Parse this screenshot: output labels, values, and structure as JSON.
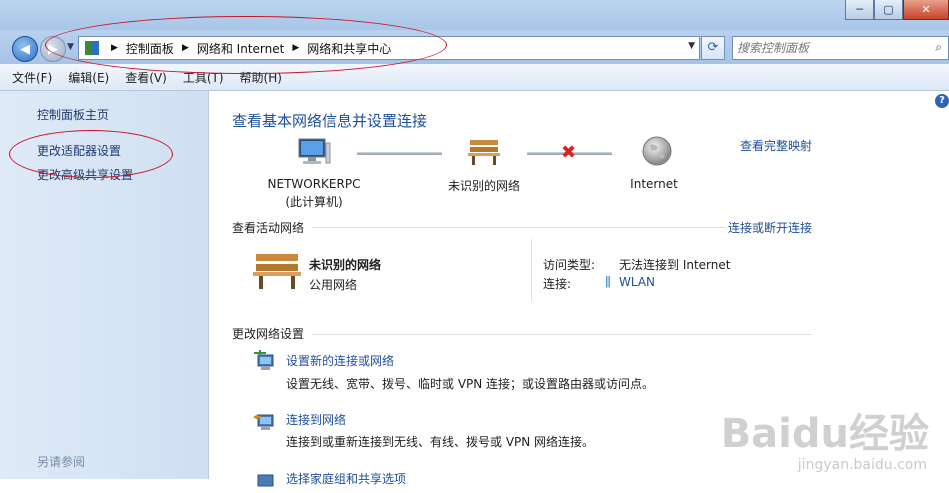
{
  "window": {
    "min": "─",
    "max": "▢",
    "close": "✕"
  },
  "nav": {
    "back_glyph": "◀",
    "forward_glyph": "▶",
    "recent_glyph": "▼",
    "refresh_glyph": "⟳"
  },
  "breadcrumb": [
    "控制面板",
    "网络和 Internet",
    "网络和共享中心"
  ],
  "search": {
    "placeholder": "搜索控制面板"
  },
  "menu": [
    "文件(F)",
    "编辑(E)",
    "查看(V)",
    "工具(T)",
    "帮助(H)"
  ],
  "sidebar": {
    "items": [
      {
        "label": "控制面板主页"
      },
      {
        "label": "更改适配器设置"
      },
      {
        "label": "更改高级共享设置"
      }
    ],
    "see_also": "另请参阅"
  },
  "main": {
    "help_glyph": "?",
    "heading": "查看基本网络信息并设置连接",
    "full_map_link": "查看完整映射",
    "map": {
      "computer_name": "NETWORKERPC",
      "computer_sub": "(此计算机)",
      "network_label": "未识别的网络",
      "internet_label": "Internet",
      "broken_glyph": "✖"
    },
    "active_networks": {
      "title": "查看活动网络",
      "link": "连接或断开连接",
      "network_name": "未识别的网络",
      "network_type": "公用网络",
      "access_type_label": "访问类型:",
      "access_type_value": "无法连接到 Internet",
      "connections_label": "连接:",
      "connections_value": "WLAN"
    },
    "change_settings": {
      "title": "更改网络设置",
      "tasks": [
        {
          "title": "设置新的连接或网络",
          "desc": "设置无线、宽带、拨号、临时或 VPN 连接；或设置路由器或访问点。"
        },
        {
          "title": "连接到网络",
          "desc": "连接到或重新连接到无线、有线、拨号或 VPN 网络连接。"
        },
        {
          "title": "选择家庭组和共享选项",
          "desc": ""
        }
      ]
    }
  },
  "watermark": {
    "logo": "Baidu经验",
    "url": "jingyan.baidu.com"
  },
  "colors": {
    "link": "#1f4e9b",
    "annotation": "#c8142a"
  }
}
